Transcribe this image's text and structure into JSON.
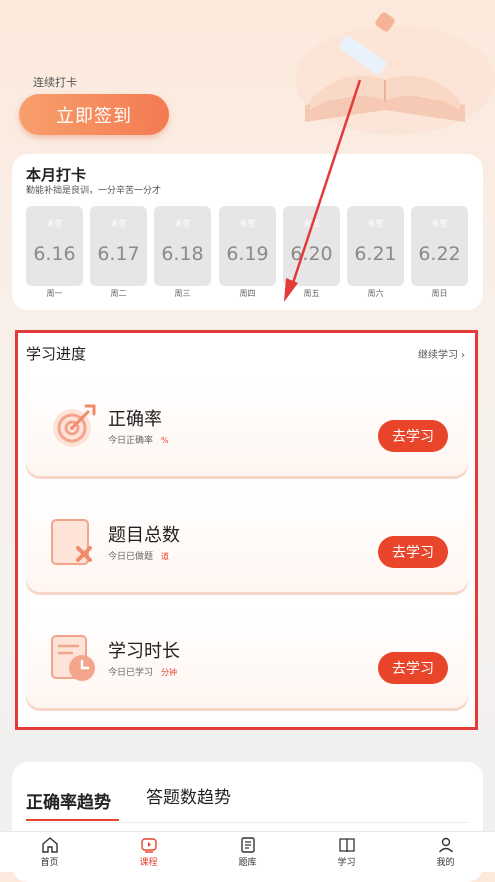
{
  "header": {
    "streak_label": "连续打卡",
    "checkin_button": "立即签到"
  },
  "month": {
    "title": "本月打卡",
    "subtitle": "勤能补拙是良训，一分辛苦一分才",
    "days": [
      {
        "status": "未签",
        "date": "6.16",
        "week": "周一"
      },
      {
        "status": "未签",
        "date": "6.17",
        "week": "周二"
      },
      {
        "status": "未签",
        "date": "6.18",
        "week": "周三"
      },
      {
        "status": "未签",
        "date": "6.19",
        "week": "周四"
      },
      {
        "status": "未签",
        "date": "6.20",
        "week": "周五"
      },
      {
        "status": "未签",
        "date": "6.21",
        "week": "周六"
      },
      {
        "status": "未签",
        "date": "6.22",
        "week": "周日"
      }
    ]
  },
  "progress": {
    "title": "学习进度",
    "continue_link": "继续学习 ›",
    "items": [
      {
        "title": "正确率",
        "sub": "今日正确率",
        "unit": "%",
        "button": "去学习",
        "icon": "target-icon"
      },
      {
        "title": "题目总数",
        "sub": "今日已做题",
        "unit": "道",
        "button": "去学习",
        "icon": "question-sheet-icon"
      },
      {
        "title": "学习时长",
        "sub": "今日已学习",
        "unit": "分钟",
        "button": "去学习",
        "icon": "clock-icon"
      }
    ]
  },
  "trend": {
    "tab_accuracy": "正确率趋势",
    "tab_count": "答题数趋势"
  },
  "nav": [
    {
      "label": "首页",
      "icon": "home-icon"
    },
    {
      "label": "课程",
      "icon": "play-icon"
    },
    {
      "label": "题库",
      "icon": "document-icon"
    },
    {
      "label": "学习",
      "icon": "book-icon"
    },
    {
      "label": "我的",
      "icon": "user-icon"
    }
  ],
  "colors": {
    "accent": "#e9452b",
    "annotation": "#e33a3a",
    "checkin_gradient_start": "#f7a06c",
    "checkin_gradient_end": "#f47a52"
  }
}
